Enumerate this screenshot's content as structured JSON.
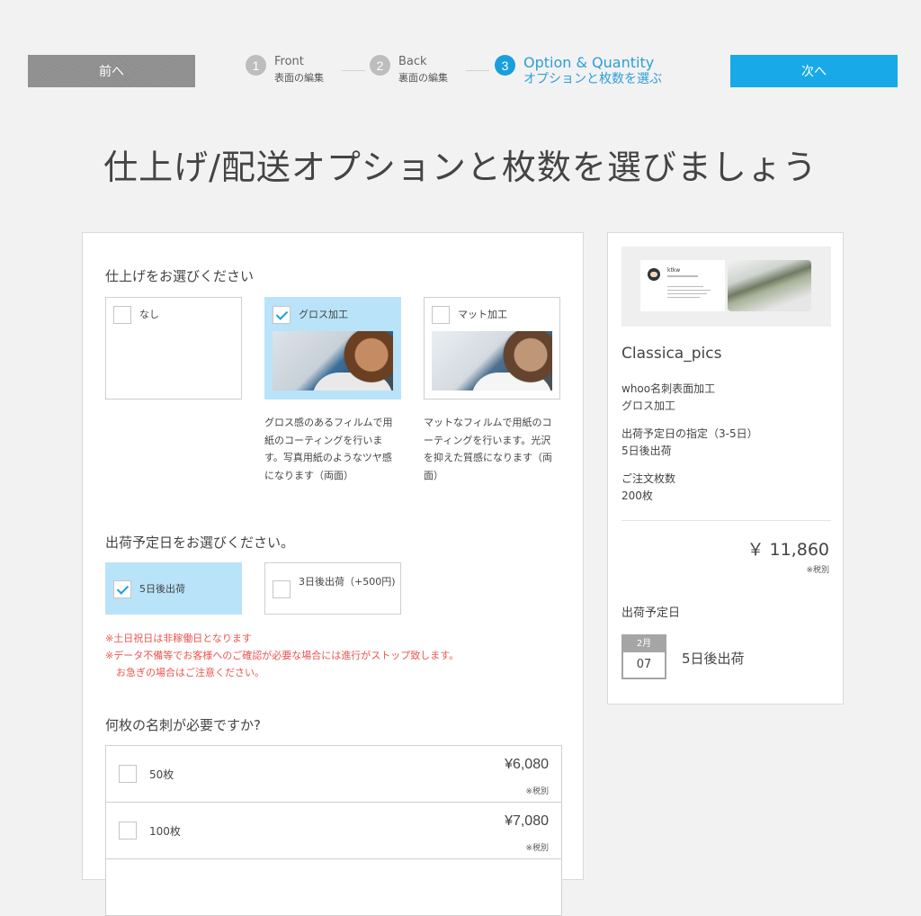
{
  "nav": {
    "prev_label": "前へ",
    "next_label": "次へ",
    "steps": [
      {
        "num": "1",
        "en": "Front",
        "jp": "表面の編集"
      },
      {
        "num": "2",
        "en": "Back",
        "jp": "裏面の編集"
      },
      {
        "num": "3",
        "en": "Option & Quantity",
        "jp": "オプションと枚数を選ぶ"
      }
    ],
    "active_color": "#1a9fdd"
  },
  "page_title": "仕上げ/配送オプションと枚数を選びましょう",
  "finish": {
    "title": "仕上げをお選びください",
    "options": [
      {
        "label": "なし",
        "checked": false
      },
      {
        "label": "グロス加工",
        "checked": true,
        "desc": "グロス感のあるフィルムで用紙のコーティングを行います。写真用紙のようなツヤ感になります（両面）"
      },
      {
        "label": "マット加工",
        "checked": false,
        "desc": "マットなフィルムで用紙のコーティングを行います。光沢を抑えた質感になります（両面）"
      }
    ]
  },
  "shipping": {
    "title": "出荷予定日をお選びください。",
    "options": [
      {
        "label": "5日後出荷",
        "checked": true
      },
      {
        "label": "3日後出荷（+500円)",
        "checked": false
      }
    ],
    "warnings": [
      "※土日祝日は非稼働日となります",
      "※データ不備等でお客様へのご確認が必要な場合には進行がストップ致します。",
      "お急ぎの場合はご注意ください。"
    ]
  },
  "quantity": {
    "title": "何枚の名刺が必要ですか?",
    "rows": [
      {
        "label": "50枚",
        "price": "¥6,080",
        "tax": "※税別",
        "checked": false
      },
      {
        "label": "100枚",
        "price": "¥7,080",
        "tax": "※税別",
        "checked": false
      }
    ]
  },
  "summary": {
    "card_name": "ktkw",
    "product_name": "Classica_pics",
    "finish_heading": "whoo名刺表面加工",
    "finish_value": "グロス加工",
    "ship_heading": "出荷予定日の指定（3-5日）",
    "ship_value": "5日後出荷",
    "qty_heading": "ご注文枚数",
    "qty_value": "200枚",
    "total_price": "￥ 11,860",
    "tax_note": "※税別",
    "ship_date_title": "出荷予定日",
    "cal_month": "2月",
    "cal_day": "07",
    "cal_label": "5日後出荷"
  }
}
